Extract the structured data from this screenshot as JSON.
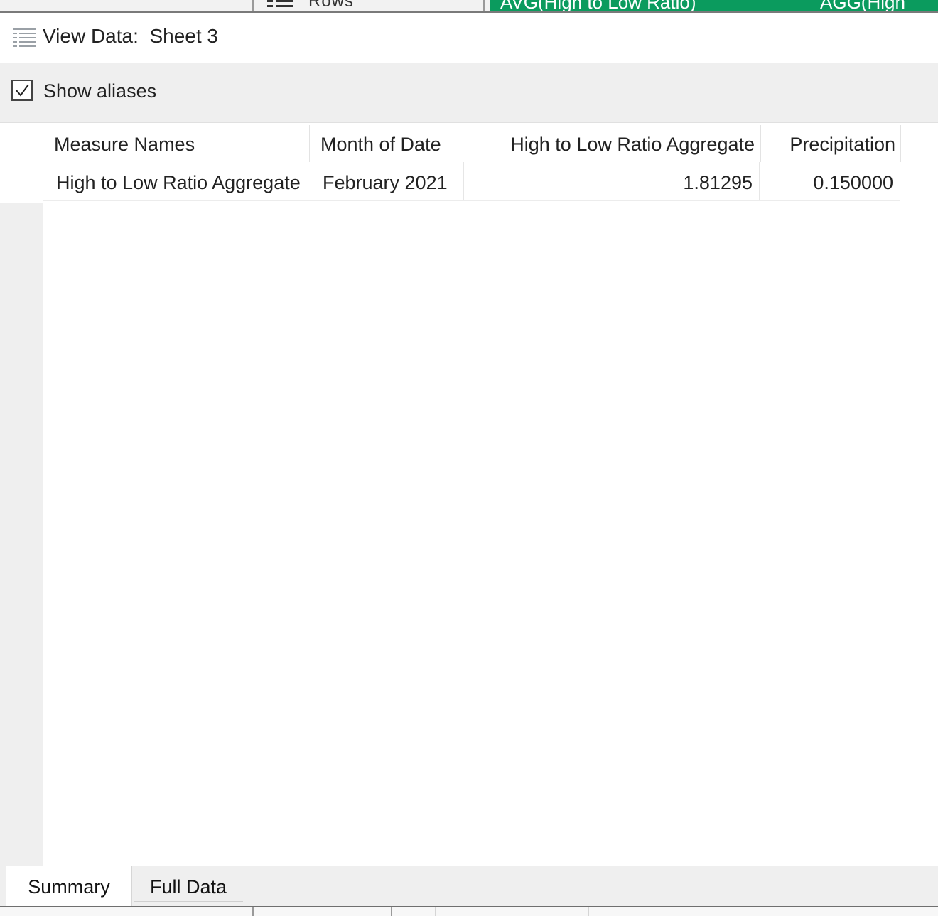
{
  "background": {
    "shelf_label": "Rows",
    "pills": [
      "AVG(High to Low Ratio)",
      "AGG(High"
    ],
    "pill_color": "#0b9b5e"
  },
  "dialog": {
    "title": "View Data:  Sheet 3",
    "title_icon": "view-data-icon"
  },
  "options": {
    "show_aliases_label": "Show aliases",
    "show_aliases_checked": true
  },
  "table": {
    "columns": [
      "Measure Names",
      "Month of Date",
      "High to Low Ratio Aggregate",
      "Precipitation"
    ],
    "rows": [
      [
        "High to Low Ratio Aggregate",
        "February 2021",
        "1.81295",
        "0.150000"
      ]
    ]
  },
  "tabs": [
    {
      "label": "Summary",
      "active": true
    },
    {
      "label": "Full Data",
      "active": false
    }
  ]
}
